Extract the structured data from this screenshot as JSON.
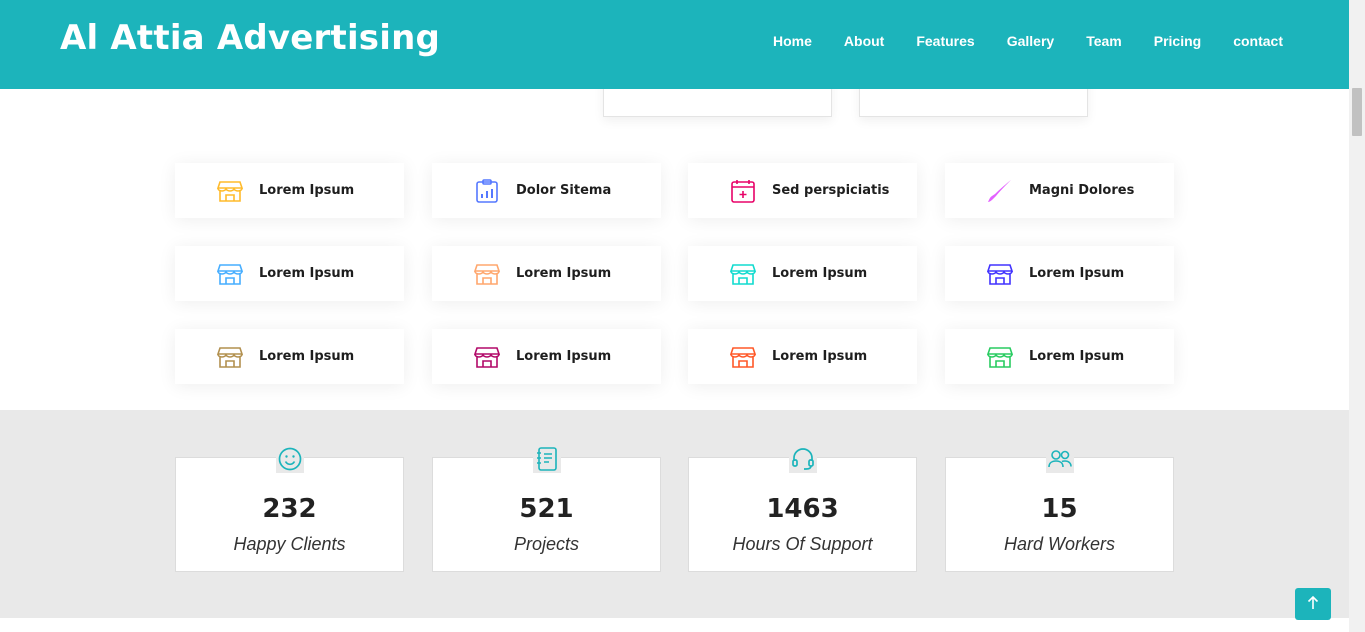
{
  "header": {
    "logo": "Al Attia Advertising",
    "nav": [
      {
        "label": "Home"
      },
      {
        "label": "About"
      },
      {
        "label": "Features"
      },
      {
        "label": "Gallery"
      },
      {
        "label": "Team"
      },
      {
        "label": "Pricing"
      },
      {
        "label": "contact"
      }
    ]
  },
  "features": [
    {
      "label": "Lorem Ipsum",
      "icon": "store-icon",
      "color": "#ffbb2c"
    },
    {
      "label": "Dolor Sitema",
      "icon": "bar-chart-icon",
      "color": "#5578ff"
    },
    {
      "label": "Sed perspiciatis",
      "icon": "calendar-plus-icon",
      "color": "#e80368"
    },
    {
      "label": "Magni Dolores",
      "icon": "paint-brush-icon",
      "color": "#e361ff"
    },
    {
      "label": "Lorem Ipsum",
      "icon": "store-icon",
      "color": "#47aeff"
    },
    {
      "label": "Lorem Ipsum",
      "icon": "store-icon",
      "color": "#ffa76e"
    },
    {
      "label": "Lorem Ipsum",
      "icon": "store-icon",
      "color": "#11dbcf"
    },
    {
      "label": "Lorem Ipsum",
      "icon": "store-icon",
      "color": "#4233ff"
    },
    {
      "label": "Lorem Ipsum",
      "icon": "store-icon",
      "color": "#b2904f"
    },
    {
      "label": "Lorem Ipsum",
      "icon": "store-icon",
      "color": "#b20969"
    },
    {
      "label": "Lorem Ipsum",
      "icon": "store-icon",
      "color": "#ff5828"
    },
    {
      "label": "Lorem Ipsum",
      "icon": "store-icon",
      "color": "#29cc61"
    }
  ],
  "counts": [
    {
      "number": "232",
      "label": "Happy Clients",
      "icon": "smiley-icon"
    },
    {
      "number": "521",
      "label": "Projects",
      "icon": "journal-icon"
    },
    {
      "number": "1463",
      "label": "Hours Of Support",
      "icon": "headset-icon"
    },
    {
      "number": "15",
      "label": "Hard Workers",
      "icon": "people-icon"
    }
  ],
  "colors": {
    "brand": "#1cb4bb",
    "section_bg": "#e9e9e9"
  }
}
